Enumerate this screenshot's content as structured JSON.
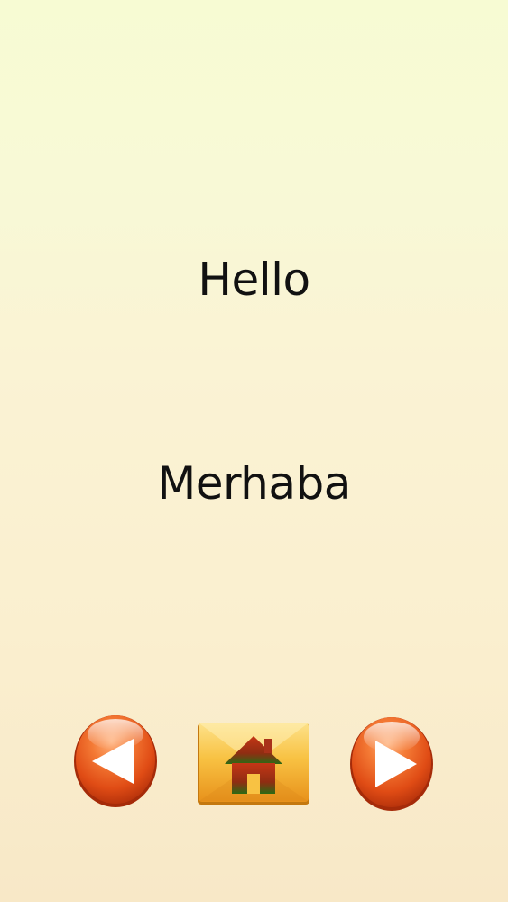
{
  "lesson": {
    "english_word": "Hello",
    "translation": "Merhaba"
  },
  "navigation": {
    "previous_icon": "left-arrow-icon",
    "home_icon": "home-icon",
    "next_icon": "right-arrow-icon"
  },
  "colors": {
    "background_top": "#f7fbd3",
    "background_bottom": "#f8e8c7",
    "arrow_button": "#e8531a",
    "home_button": "#f5b52d",
    "home_icon": "#9b2f1a",
    "text": "#111111"
  }
}
